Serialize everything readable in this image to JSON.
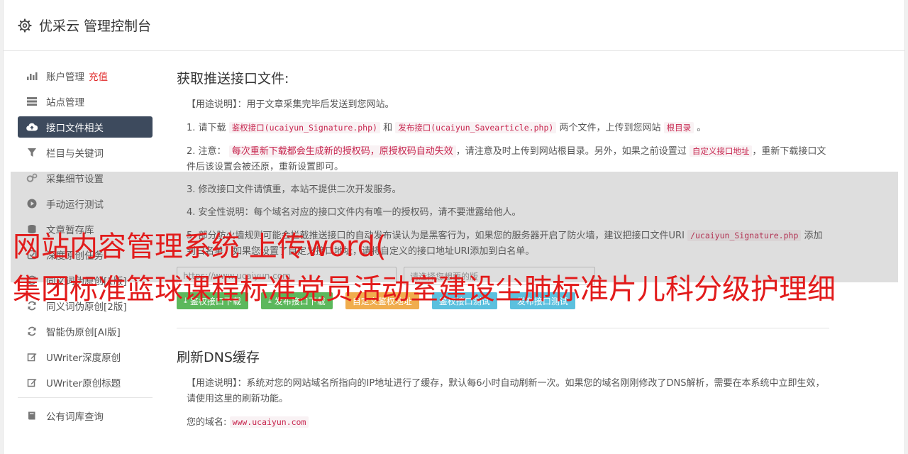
{
  "app": {
    "title": "优采云 管理控制台"
  },
  "sidebar": {
    "items": [
      {
        "label": "账户管理",
        "extra": "充值",
        "icon": "bar-chart-icon"
      },
      {
        "label": "站点管理",
        "icon": "server-icon"
      },
      {
        "label": "接口文件相关",
        "icon": "cloud-upload-icon",
        "active": true
      },
      {
        "label": "栏目与关键词",
        "icon": "filter-icon"
      },
      {
        "label": "采集细节设置",
        "icon": "gears-icon"
      },
      {
        "label": "手动运行测试",
        "icon": "play-icon"
      },
      {
        "label": "文章暂存库",
        "icon": "database-icon"
      },
      {
        "label": "深度原创任务",
        "icon": "task-icon"
      },
      {
        "label": "同义词伪原创[1版]",
        "icon": "refresh-icon"
      },
      {
        "label": "同义词伪原创[2版]",
        "icon": "refresh-icon"
      },
      {
        "label": "智能伪原创[AI版]",
        "icon": "refresh-icon"
      },
      {
        "label": "UWriter深度原创",
        "icon": "edit-icon"
      },
      {
        "label": "UWriter原创标题",
        "icon": "edit-icon"
      },
      {
        "label": "公有词库查询",
        "icon": "book-icon"
      }
    ]
  },
  "section1": {
    "title": "获取推送接口文件:",
    "usage_label": "【用途说明】",
    "usage_text": "：用于文章采集完毕后发送到您网站。",
    "s1_a": "1. 请下载",
    "s1_code1": "鉴权接口(ucaiyun_Signature.php)",
    "s1_b": "和",
    "s1_code2": "发布接口(ucaiyun_Savearticle.php)",
    "s1_c": "两个文件，上传到您网站",
    "s1_code3": "根目录",
    "s1_d": "。",
    "s2_a": "2. 注意：",
    "s2_red": "每次重新下载都会生成新的授权码，原授权码自动失效",
    "s2_b": "，请注意及时上传到网站根目录。另外，如果之前设置过",
    "s2_code": "自定义接口地址",
    "s2_c": "，重新下载接口文件后该设置会被还原，重新设置即可。",
    "s3": "3. 修改接口文件请慎重，本站不提供二次开发服务。",
    "s4": "4. 安全性说明：每个域名对应的接口文件内有唯一的授权码，请不要泄露给他人。",
    "s5_a": "5. 部分防火墙规则可能会拦截推送接口的自动发布误认为是黑客行为，如果您的服务器开启了防火墙，建议把接口文件URI",
    "s5_code": "/ucaiyun_Signature.php",
    "s5_b": "添加到白名单，如果您设置了自定义接口地址，请将自定义的接口地址URI添加到白名单。",
    "input1_placeholder": "https://www.ucaiyun.com",
    "input2_placeholder": "请选择您想要的版",
    "buttons": {
      "sig_download": "鉴权接口下载",
      "pub_download": "发布接口下载",
      "custom_sig": "自定义鉴权地址",
      "sig_test": "鉴权接口测试",
      "pub_test": "发布接口测试"
    }
  },
  "section2": {
    "title": "刷新DNS缓存",
    "usage_label": "【用途说明】",
    "usage_text": "：系统对您的网站域名所指向的IP地址进行了缓存，默认每6小时自动刷新一次。如果您的域名刚刚修改了DNS解析，需要在本系统中立即生效，请使用这里的刷新功能。",
    "domain_label": "您的域名:",
    "domain_value": "www.ucaiyun.com"
  },
  "overlay": {
    "line1": "网站内容管理系统 上传word(",
    "line2": "集团标准篮球课程标准党员活动室建设尘肺标准片儿科分级护理细"
  },
  "colors": {
    "accent_nav": "#3d4a5d",
    "overlay_text": "#e21b1b",
    "btn_green": "#5cb85c",
    "btn_orange": "#f0ad4e",
    "btn_blue": "#5bc0de"
  }
}
